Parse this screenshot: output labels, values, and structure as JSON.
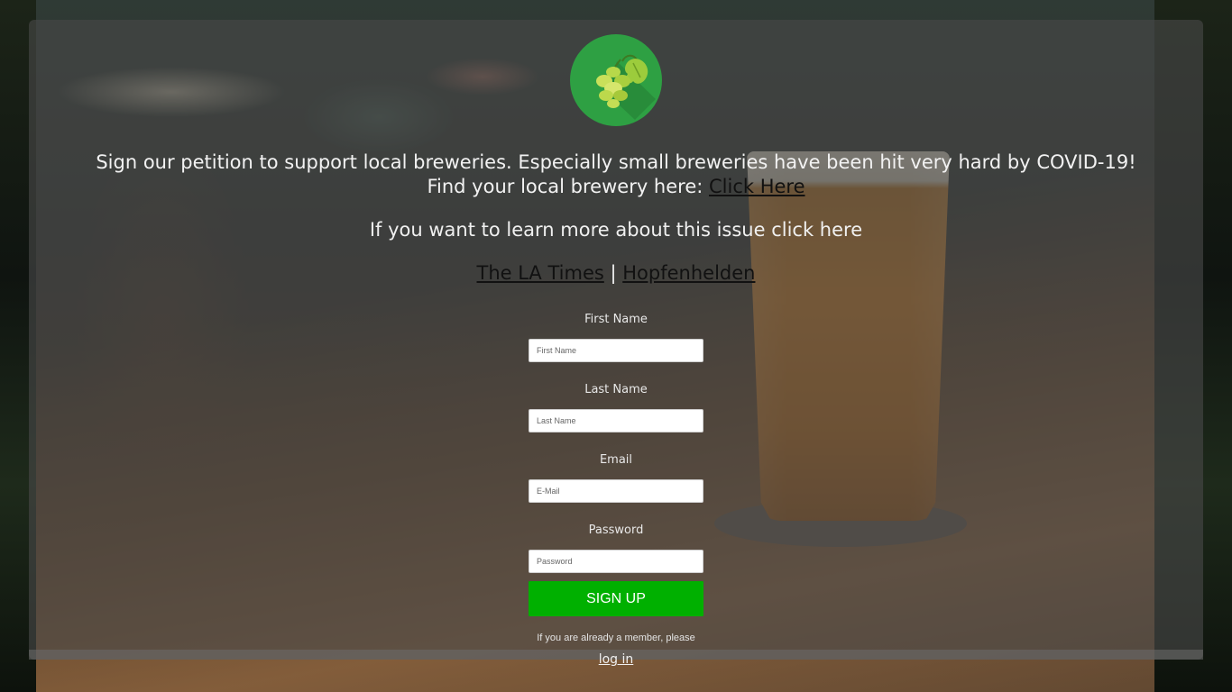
{
  "petition": {
    "line1": "Sign our petition to support local breweries. Especially small breweries have been hit very hard by COVID-19!",
    "line2_prefix": "Find your local brewery here: ",
    "line2_link": "Click Here",
    "learn_more": "If you want to learn more about this issue click here",
    "sources": {
      "first": "The LA Times",
      "separator": " | ",
      "second": "Hopfenhelden"
    }
  },
  "form": {
    "first_name_label": "First Name",
    "first_name_placeholder": "First Name",
    "last_name_label": "Last Name",
    "last_name_placeholder": "Last Name",
    "email_label": "Email",
    "email_placeholder": "E-Mail",
    "password_label": "Password",
    "password_placeholder": "Password",
    "signup_label": "SIGN UP",
    "member_note": "If you are already a member, please",
    "login_label": "log in"
  },
  "icons": {
    "logo": "hop-logo-icon"
  },
  "colors": {
    "signup_button": "#00b000",
    "logo_background": "#2ea043",
    "overlay": "rgba(72,72,72,0.62)"
  }
}
